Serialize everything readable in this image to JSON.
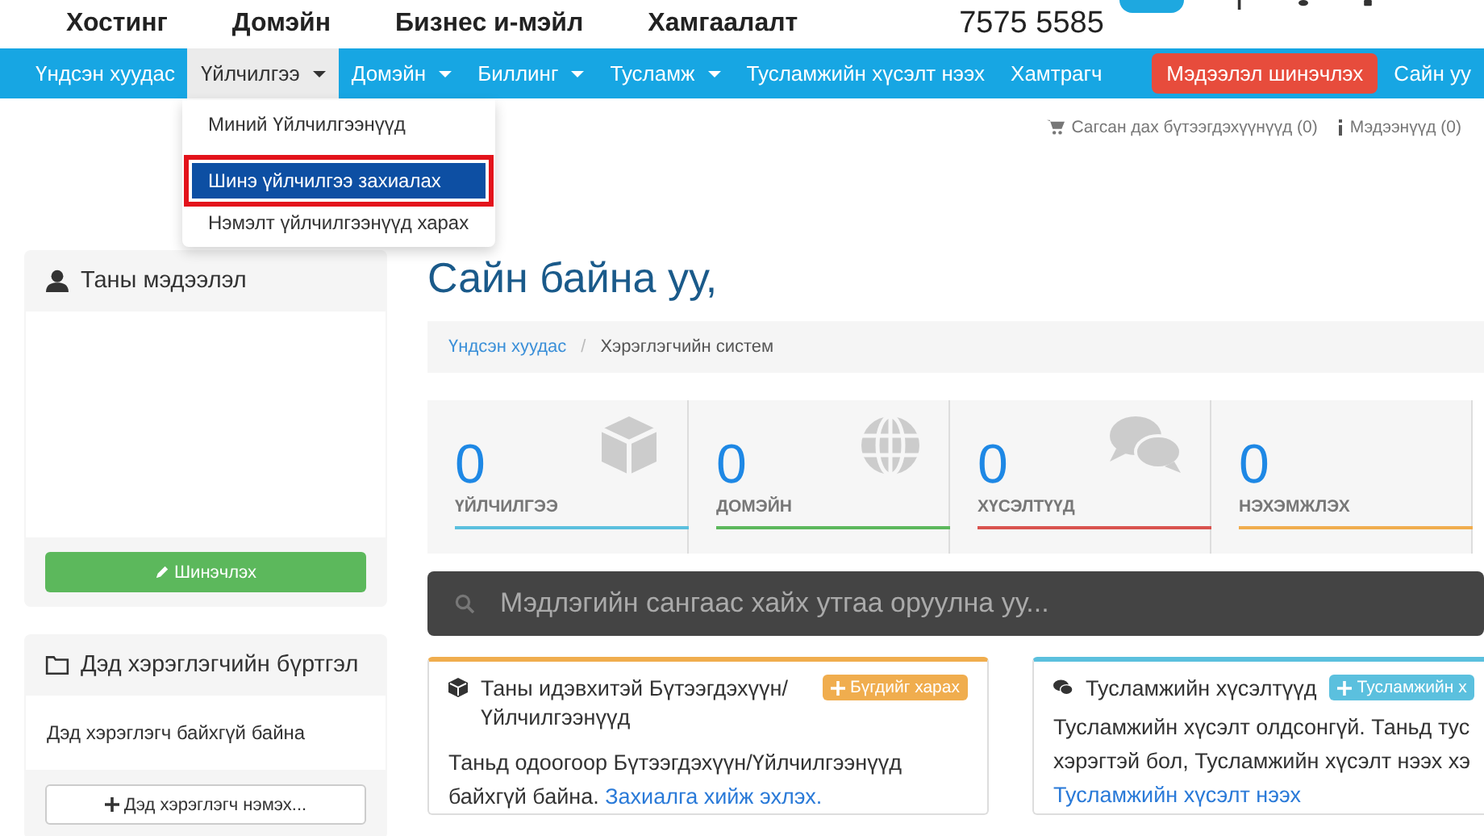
{
  "top_header": {
    "links": [
      "Хостинг",
      "Домэйн",
      "Бизнес и-мэйл",
      "Хамгаалалт"
    ],
    "phone": "7575 5585"
  },
  "navbar": {
    "items": [
      {
        "label": "Үндсэн хуудас",
        "selected": false,
        "dropdown": false
      },
      {
        "label": "Үйлчилгээ",
        "selected": true,
        "dropdown": true
      },
      {
        "label": "Домэйн",
        "selected": false,
        "dropdown": true
      },
      {
        "label": "Биллинг",
        "selected": false,
        "dropdown": true
      },
      {
        "label": "Тусламж",
        "selected": false,
        "dropdown": true
      },
      {
        "label": "Тусламжийн хүсэлт нээх",
        "selected": false,
        "dropdown": false
      },
      {
        "label": "Хамтрагч",
        "selected": false,
        "dropdown": false
      }
    ],
    "update_button": "Мэдээлэл шинэчлэх",
    "greeting": "Сайн уу"
  },
  "dropdown_menu": {
    "items": [
      {
        "label": "Миний Үйлчилгээнүүд",
        "selected": false
      },
      {
        "label": "Шинэ үйлчилгээ захиалах",
        "selected": true
      },
      {
        "label": "Нэмэлт үйлчилгээнүүд харах",
        "selected": false
      }
    ]
  },
  "utility_links": [
    "Сагсан дах бүтээгдэхүүнүүд (0)",
    "Мэдээнүүд (0)"
  ],
  "sidebar": {
    "profile_panel": {
      "title": "Таны мэдээлэл",
      "button": "Шинэчлэх"
    },
    "subaccount_panel": {
      "title": "Дэд хэрэглэгчийн бүртгэл",
      "message": "Дэд хэрэглэгч байхгүй байна",
      "button": "Дэд хэрэглэгч нэмэх..."
    }
  },
  "page_title": "Сайн байна уу,",
  "breadcrumb": [
    "Үндсэн хуудас",
    "Хэрэглэгчийн систем"
  ],
  "breadcrumb_separator": "/",
  "stats": [
    {
      "value": "0",
      "label": "ҮЙЛЧИЛГЭЭ",
      "color": "#5bc0de"
    },
    {
      "value": "0",
      "label": "ДОМЭЙН",
      "color": "#5cb85c"
    },
    {
      "value": "0",
      "label": "ХҮСЭЛТҮҮД",
      "color": "#d9534f"
    },
    {
      "value": "0",
      "label": "НЭХЭМЖЛЭХ",
      "color": "#f0ad4e"
    }
  ],
  "search": {
    "placeholder": "Мэдлэгийн сангаас хайх утгаа оруулна уу..."
  },
  "panels": [
    {
      "title": "Таны идэвхитэй Бүтээгдэхүүн/ Үйлчилгээнүүд",
      "button": "Бүгдийг харах",
      "color": "#f0ad4e",
      "text": "Таньд одоогоор Бүтээгдэхүүн/Үйлчилгээнүүд байхгүй байна.",
      "link": "Захиалга хийж эхлэх."
    },
    {
      "title": "Тусламжийн хүсэлтүүд",
      "button": "Тусламжийн х",
      "color": "#5bc0de",
      "text": "Тусламжийн хүсэлт олдсонгүй. Таньд тус",
      "text_2": "хэрэгтэй бол, Тусламжийн хүсэлт нээх хэ",
      "link": "Тусламжийн хүсэлт нээх"
    }
  ]
}
